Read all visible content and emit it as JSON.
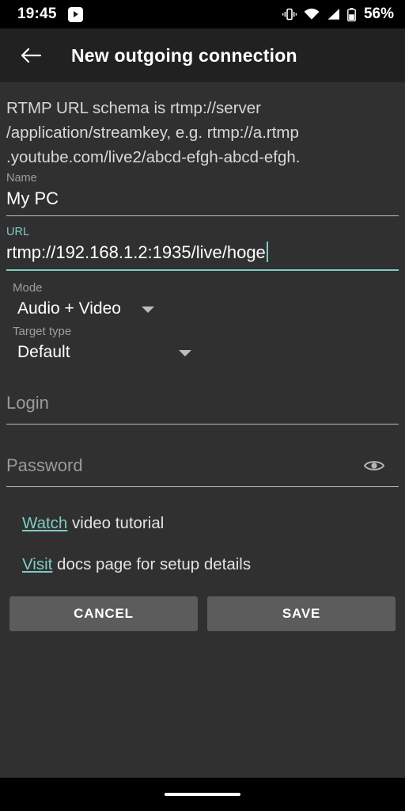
{
  "status_bar": {
    "time": "19:45",
    "notification_icon": "play-badge-icon",
    "icons": [
      "vibrate-icon",
      "wifi-icon",
      "cellular-signal-icon",
      "battery-icon"
    ],
    "battery_percent": "56%"
  },
  "toolbar": {
    "back_icon": "back-arrow-icon",
    "title": "New outgoing connection"
  },
  "hint": {
    "text": "RTMP URL schema is rtmp://server\n/application/streamkey, e.g. rtmp://a.rtmp\n.youtube.com/live2/abcd-efgh-abcd-efgh."
  },
  "form": {
    "name": {
      "label": "Name",
      "value": "My PC",
      "placeholder": "Name"
    },
    "url": {
      "label": "URL",
      "value": "rtmp://192.168.1.2:1935/live/hoge",
      "placeholder": "URL",
      "focused": true,
      "accent_color": "#80cbc4"
    },
    "mode": {
      "label": "Mode",
      "value": "Audio + Video",
      "arrow_icon": "chevron-down-icon"
    },
    "target_type": {
      "label": "Target type",
      "value": "Default",
      "arrow_icon": "chevron-down-icon"
    },
    "login": {
      "placeholder": "Login",
      "value": ""
    },
    "password": {
      "placeholder": "Password",
      "value": "",
      "reveal_icon": "eye-icon"
    }
  },
  "links": {
    "watch": {
      "link_text": "Watch",
      "rest_text": " video tutorial"
    },
    "visit": {
      "link_text": "Visit",
      "rest_text": " docs page for setup details"
    }
  },
  "actions": {
    "cancel_label": "CANCEL",
    "save_label": "SAVE"
  },
  "nav_bar": {
    "home_pill": "home-gesture-pill"
  }
}
